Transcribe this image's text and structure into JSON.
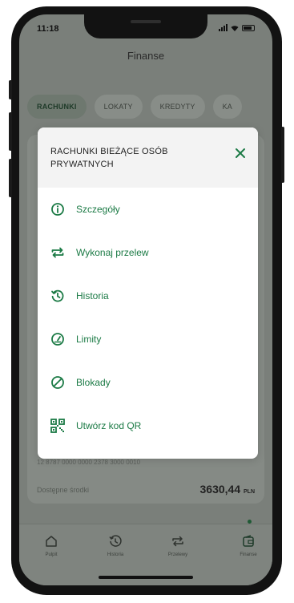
{
  "status_bar": {
    "time": "11:18"
  },
  "header": {
    "title": "Finanse"
  },
  "tabs": [
    {
      "label": "RACHUNKI",
      "active": true
    },
    {
      "label": "LOKATY",
      "active": false
    },
    {
      "label": "KREDYTY",
      "active": false
    },
    {
      "label": "KA",
      "active": false
    }
  ],
  "account": {
    "number": "12 8787 0000 0000 2378 3000 0010",
    "available_label": "Dostępne środki",
    "available_amount": "3630,44",
    "currency": "PLN"
  },
  "modal": {
    "title": "RACHUNKI BIEŻĄCE OSÓB PRYWATNYCH",
    "items": [
      {
        "label": "Szczegóły",
        "icon": "info-icon"
      },
      {
        "label": "Wykonaj przelew",
        "icon": "transfer-icon"
      },
      {
        "label": "Historia",
        "icon": "history-icon"
      },
      {
        "label": "Limity",
        "icon": "gauge-icon"
      },
      {
        "label": "Blokady",
        "icon": "block-icon"
      },
      {
        "label": "Utwórz kod QR",
        "icon": "qr-code-icon"
      }
    ]
  },
  "bottom_nav": [
    {
      "label": "Pulpit",
      "icon": "home-icon"
    },
    {
      "label": "Historia",
      "icon": "history-icon"
    },
    {
      "label": "Przelewy",
      "icon": "transfer-icon"
    },
    {
      "label": "Finanse",
      "icon": "wallet-icon",
      "active": true
    }
  ],
  "colors": {
    "accent": "#1b7a45",
    "overlay": "#7a7f7a"
  }
}
